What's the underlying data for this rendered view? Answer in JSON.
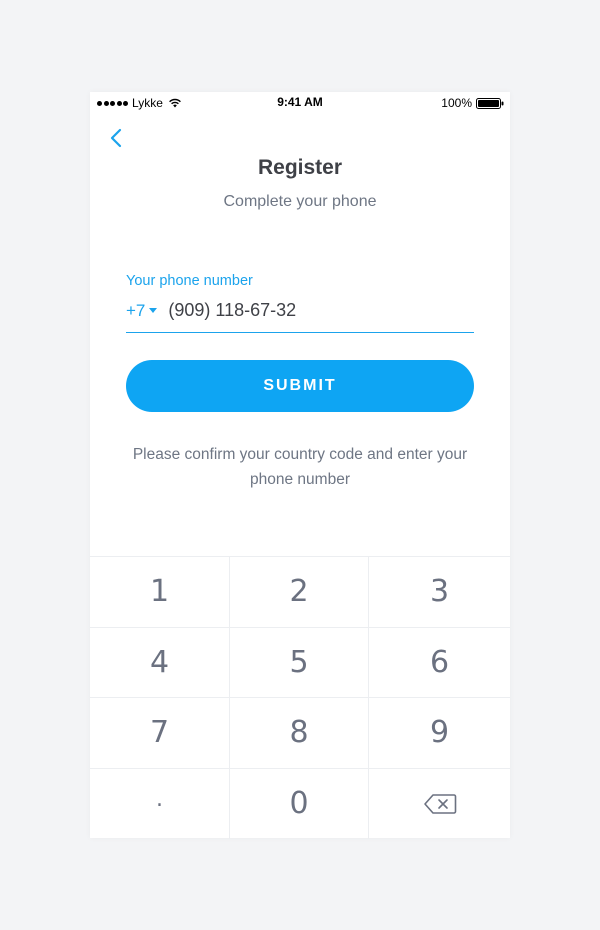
{
  "status_bar": {
    "carrier": "Lykke",
    "time": "9:41 AM",
    "battery": "100%"
  },
  "header": {
    "back_icon": "chevron-left-icon",
    "title": "Register",
    "subtitle": "Complete your phone"
  },
  "phone_field": {
    "label": "Your phone number",
    "country_code": "+7",
    "value": "(909) 118-67-32"
  },
  "submit": {
    "label": "SUBMIT"
  },
  "help_text": "Please confirm your country code and enter your phone number",
  "keypad": {
    "keys": [
      "1",
      "2",
      "3",
      "4",
      "5",
      "6",
      "7",
      "8",
      "9",
      ".",
      "0"
    ],
    "backspace_icon": "backspace-icon"
  },
  "colors": {
    "accent": "#1ba3ec",
    "button": "#0ea5f3",
    "title": "#3f4147",
    "muted": "#6e7684",
    "background": "#f3f4f6"
  }
}
